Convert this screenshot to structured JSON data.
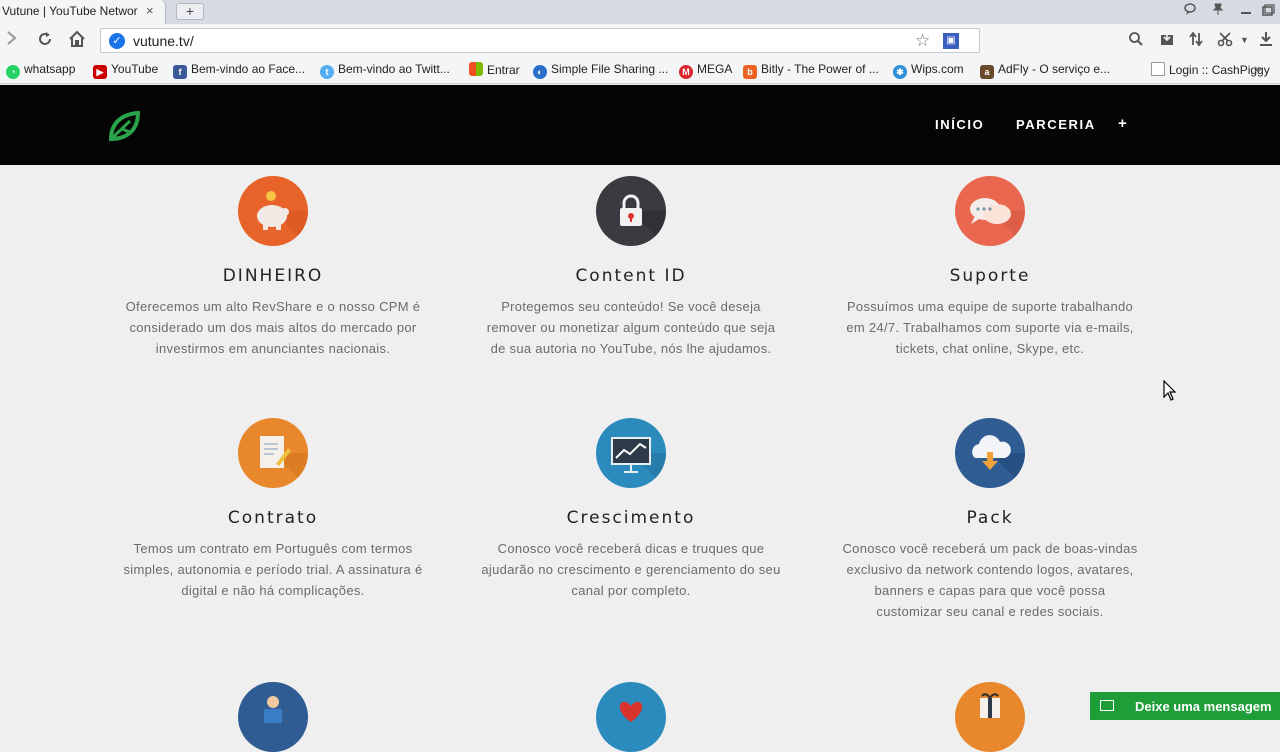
{
  "browser": {
    "tab_title": "Vutune | YouTube Networ",
    "tab_close": "×",
    "new_tab": "+",
    "url": "vutune.tv/",
    "bookmarks": [
      {
        "label": "whatsapp",
        "icon": "whatsapp-icon",
        "color": "#25d366"
      },
      {
        "label": "YouTube",
        "icon": "youtube-icon",
        "color": "#cc0000"
      },
      {
        "label": "Bem-vindo ao Face...",
        "icon": "facebook-icon",
        "color": "#3b5998"
      },
      {
        "label": "Bem-vindo ao Twitt...",
        "icon": "twitter-icon",
        "color": "#55acee"
      },
      {
        "label": "Entrar",
        "icon": "microsoft-icon",
        "color": "#f25022"
      },
      {
        "label": "Simple File Sharing ...",
        "icon": "file-sharing-icon",
        "color": "#2a6fc9"
      },
      {
        "label": "MEGA",
        "icon": "mega-icon",
        "color": "#d9272e"
      },
      {
        "label": "Bitly - The Power of ...",
        "icon": "bitly-icon",
        "color": "#ee6123"
      },
      {
        "label": "Wips.com",
        "icon": "wips-icon",
        "color": "#2f8fd8"
      },
      {
        "label": "AdFly - O serviço e...",
        "icon": "adfly-icon",
        "color": "#6b4a2a"
      },
      {
        "label": "Login :: CashPiggy",
        "icon": "page-icon",
        "color": "#ffffff"
      }
    ],
    "bookmarks_more": "»"
  },
  "site": {
    "nav": {
      "inicio": "INÍCIO",
      "parceria": "PARCERIA",
      "more": "+"
    },
    "brand_color": "#2aa34a"
  },
  "features": [
    {
      "title": "DINHEIRO",
      "text": "Oferecemos um alto RevShare e o nosso CPM é considerado um dos mais altos do mercado por investirmos em anunciantes nacionais.",
      "icon": "piggy-bank-icon",
      "color": "#e8632a"
    },
    {
      "title": "Content ID",
      "text": "Protegemos seu conteúdo! Se você deseja remover ou monetizar algum conteúdo que seja de sua autoria no YouTube, nós lhe ajudamos.",
      "icon": "lock-icon",
      "color": "#3a3a40"
    },
    {
      "title": "Suporte",
      "text": "Possuímos uma equipe de suporte trabalhando em 24/7. Trabalhamos com suporte via e-mails, tickets, chat online, Skype, etc.",
      "icon": "chat-bubbles-icon",
      "color": "#e9674f"
    },
    {
      "title": "Contrato",
      "text": "Temos um contrato em Português com termos simples, autonomia e período trial. A assinatura é digital e não há complicações.",
      "icon": "contract-icon",
      "color": "#e8872b"
    },
    {
      "title": "Crescimento",
      "text": "Conosco você receberá dicas e truques que ajudarão no crescimento e gerenciamento do seu canal por completo.",
      "icon": "growth-chart-icon",
      "color": "#2c8bbd"
    },
    {
      "title": "Pack",
      "text": "Conosco você receberá um pack de boas-vindas exclusivo da network contendo logos, avatares, banners e capas para que você possa customizar seu canal e redes sociais.",
      "icon": "cloud-download-icon",
      "color": "#2f5c93"
    }
  ],
  "chat_widget": {
    "label": "Deixe uma mensagem"
  }
}
